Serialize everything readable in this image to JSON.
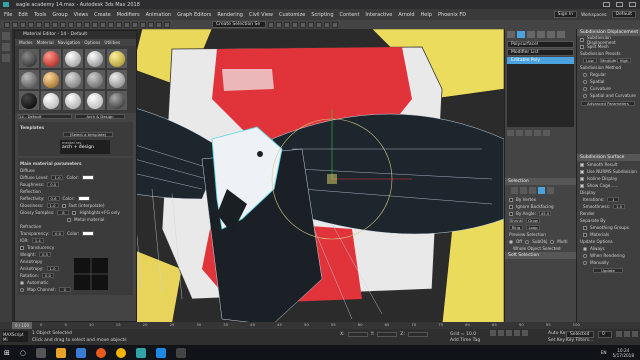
{
  "window": {
    "title": "eagle academy 14.max - Autodesk 3ds Max 2018",
    "sign_in": "Sign In",
    "workspaces_label": "Workspaces:",
    "workspace_value": "Default"
  },
  "menubar": {
    "items": [
      "File",
      "Edit",
      "Tools",
      "Group",
      "Views",
      "Create",
      "Modifiers",
      "Animation",
      "Graph Editors",
      "Rendering",
      "Civil View",
      "Customize",
      "Scripting",
      "Content",
      "Interactive",
      "Arnold",
      "Help",
      "Phoenix FD"
    ]
  },
  "toolbar": {
    "selection_set_placeholder": "Create Selection Se"
  },
  "material_editor": {
    "title": "Material Editor - 14 - Default",
    "menu": [
      "Modes",
      "Material",
      "Navigation",
      "Options",
      "Utilities"
    ],
    "material_name": "14 - Default",
    "material_type": "Arch & Design",
    "templates_title": "Templates",
    "template_select": "(Select a template)",
    "logo_line1": "mental ray",
    "logo_line2": "arch + design",
    "main_params_title": "Main material parameters",
    "diffuse_title": "Diffuse",
    "diffuse_level_label": "Diffuse Level:",
    "diffuse_level_value": "1.0",
    "roughness_label": "Roughness:",
    "roughness_value": "0.0",
    "color_label": "Color:",
    "reflection_title": "Reflection",
    "reflectivity_label": "Reflectivity:",
    "reflectivity_value": "0.6",
    "glossiness_label": "Glossiness:",
    "glossiness_value": "1.0",
    "glossy_samples_label": "Glossy Samples:",
    "glossy_samples_value": "8",
    "fast_interp_label": "Fast (interpolate)",
    "highlights_label": "Highlights+FG only",
    "metal_label": "Metal material",
    "refraction_title": "Refraction",
    "transparency_label": "Transparency:",
    "transparency_value": "0.0",
    "ior_label": "IOR:",
    "ior_value": "1.4",
    "translucency_label": "Translucency",
    "weight_label": "Weight:",
    "weight_value": "0.5",
    "anisotropy_title": "Anisotropy",
    "anisotropy_label": "Anisotropy:",
    "anisotropy_value": "1.0",
    "rotation_label": "Rotation:",
    "rotation_value": "0.0",
    "automatic_label": "Automatic",
    "map_channel_label": "Map Channel:",
    "map_channel_value": "0"
  },
  "command_panel": {
    "object_name": "Polysurfacel",
    "modifier_list_label": "Modifier List",
    "stack_item": "Editable Poly",
    "selection_title": "Selection",
    "by_vertex": "By Vertex",
    "ignore_backfacing": "Ignore Backfacing",
    "by_angle": "By Angle:",
    "by_angle_value": "45.0",
    "shrink": "Shrink",
    "grow": "Grow",
    "ring": "Ring",
    "loop": "Loop",
    "preview_selection": "Preview Selection",
    "off": "Off",
    "subobj": "SubObj",
    "multi": "Multi",
    "selected_status": "Whole Object Selected",
    "soft_selection_title": "Soft Selection"
  },
  "right_panel": {
    "displacement_title": "Subdivision Displacement",
    "subdivision_displacement": "Subdivision Displacement",
    "split_mesh": "Split Mesh",
    "subdiv_presets": "Subdivision Presets",
    "low": "Low",
    "medium": "Medium",
    "high": "High",
    "subdiv_method": "Subdivision Method",
    "regular": "Regular",
    "spatial": "Spatial",
    "curvature": "Curvature",
    "spatial_curv": "Spatial and Curvature",
    "advanced_params": "Advanced Parameters",
    "surface_title": "Subdivision Surface",
    "smooth_result": "Smooth Result",
    "use_nurms": "Use NURMS Subdivision",
    "isoline_display": "Isoline Display",
    "show_cage": "Show Cage......",
    "display_label": "Display",
    "iterations_label": "Iterations:",
    "iterations_value": "1",
    "smoothness_label": "Smoothness:",
    "smoothness_value": "1.0",
    "render_label": "Render",
    "separate_by": "Separate By",
    "smoothing_groups": "Smoothing Groups",
    "materials": "Materials",
    "update_options": "Update Options",
    "always": "Always",
    "when_rendering": "When Rendering",
    "manually": "Manually",
    "update_button": "Update"
  },
  "timeline": {
    "frame_display": "0 / 100",
    "ticks": [
      "0",
      "5",
      "10",
      "15",
      "20",
      "25",
      "30",
      "35",
      "40",
      "45",
      "50",
      "55",
      "60",
      "65",
      "70",
      "75",
      "80",
      "85",
      "90",
      "95",
      "100"
    ]
  },
  "status": {
    "script_label": "MAXScript Mi",
    "objects_selected": "1 Object Selected",
    "prompt": "Click and drag to select and move objects",
    "x_label": "X:",
    "y_label": "Y:",
    "z_label": "Z:",
    "grid": "Grid = 10.0",
    "add_time_tag": "Add Time Tag",
    "auto_key": "Auto Key",
    "selected_dropdown": "Selected",
    "set_key": "Set Key",
    "key_filters": "Key Filters...",
    "frame_value": "0"
  },
  "taskbar": {
    "time": "10:24",
    "date": "5/17/2018",
    "lang": "EN"
  },
  "colors": {
    "accent": "#4aa3df",
    "viewport_bg": "#2b2b2b",
    "red": "#e0343a",
    "yellow": "#f2df5c",
    "eagle_dark": "#1d252d",
    "wire": "#c9d6e6"
  }
}
